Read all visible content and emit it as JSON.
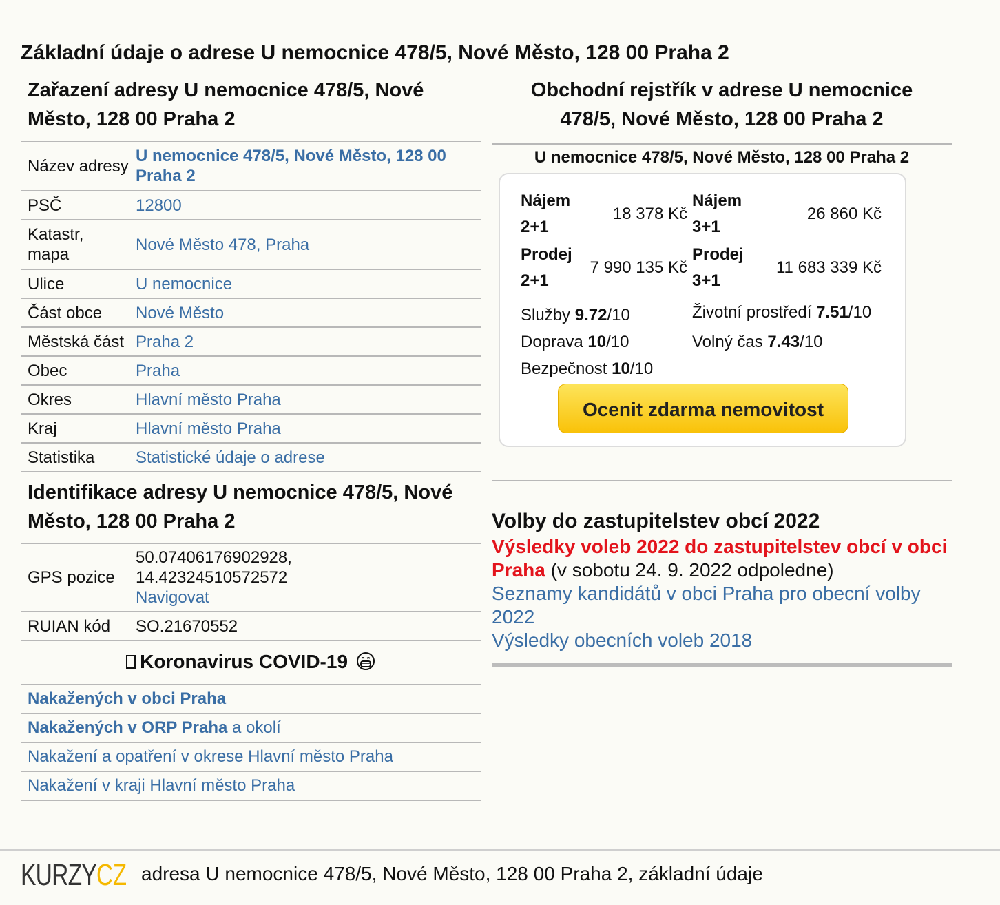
{
  "page": {
    "title": "Základní údaje o adrese U nemocnice 478/5, Nové Město, 128 00 Praha 2"
  },
  "zarazeni": {
    "heading": "Zařazení adresy U nemocnice 478/5, Nové Město, 128 00 Praha 2",
    "rows": [
      {
        "label": "Název adresy",
        "value": "U nemocnice 478/5, Nové Město, 128 00 Praha 2"
      },
      {
        "label": "PSČ",
        "value": "12800"
      },
      {
        "label": "Katastr, mapa",
        "value": "Nové Město 478, Praha"
      },
      {
        "label": "Ulice",
        "value": "U nemocnice"
      },
      {
        "label": "Část obce",
        "value": "Nové Město"
      },
      {
        "label": "Městská část",
        "value": "Praha 2"
      },
      {
        "label": "Obec",
        "value": "Praha"
      },
      {
        "label": "Okres",
        "value": "Hlavní město Praha"
      },
      {
        "label": "Kraj",
        "value": "Hlavní město Praha"
      },
      {
        "label": "Statistika",
        "value": "Statistické údaje o adrese"
      }
    ]
  },
  "identifikace": {
    "heading": "Identifikace adresy U nemocnice 478/5, Nové Město, 128 00 Praha 2",
    "gps_label": "GPS pozice",
    "gps_lat": "50.07406176902928,",
    "gps_lon": "14.42324510572572",
    "navigate": "Navigovat",
    "ruian_label": "RUIAN kód",
    "ruian_value": "SO.21670552"
  },
  "covid": {
    "heading": "Koronavirus COVID-19",
    "icon_before": "virus-icon",
    "icon_after": "mask-face-icon",
    "links": [
      {
        "bold": "Nakažených v obci Praha",
        "rest": ""
      },
      {
        "bold": "Nakažených v ORP Praha",
        "rest": " a okolí"
      },
      {
        "bold": "",
        "rest": "Nakažení a opatření v okrese Hlavní město Praha"
      },
      {
        "bold": "",
        "rest": "Nakažení v kraji Hlavní město Praha"
      }
    ]
  },
  "rejstrik": {
    "heading": "Obchodní rejstřík v adrese U nemocnice 478/5, Nové Město, 128 00 Praha 2",
    "address": "U nemocnice 478/5, Nové Město, 128 00 Praha 2",
    "prices": [
      {
        "label1": "Nájem",
        "label2": "2+1",
        "value": "18 378 Kč"
      },
      {
        "label1": "Nájem",
        "label2": "3+1",
        "value": "26 860 Kč"
      },
      {
        "label1": "Prodej",
        "label2": "2+1",
        "value": "7 990 135 Kč"
      },
      {
        "label1": "Prodej",
        "label2": "3+1",
        "value": "11 683 339 Kč"
      }
    ],
    "scores": [
      {
        "label": "Služby",
        "value": "9.72",
        "max": "/10"
      },
      {
        "label": "Životní prostředí",
        "value": "7.51",
        "max": "/10"
      },
      {
        "label": "Doprava",
        "value": "10",
        "max": "/10"
      },
      {
        "label": "Volný čas",
        "value": "7.43",
        "max": "/10"
      },
      {
        "label": "Bezpečnost",
        "value": "10",
        "max": "/10"
      }
    ],
    "button": "Ocenit zdarma nemovitost"
  },
  "volby": {
    "heading": "Volby do zastupitelstev obcí 2022",
    "red_link": "Výsledky voleb 2022 do zastupitelstev obcí v obci Praha",
    "red_suffix": " (v sobotu 24. 9. 2022 odpoledne)",
    "link2": "Seznamy kandidátů v obci Praha pro obecní volby 2022",
    "link3": "Výsledky obecních voleb 2018"
  },
  "footer": {
    "logo_left": "KURZY",
    "logo_right": "CZ",
    "text": "adresa U nemocnice 478/5, Nové Město, 128 00 Praha 2, základní údaje",
    "logo_color_dark": "#333333",
    "logo_color_accent": "#f5b800"
  }
}
